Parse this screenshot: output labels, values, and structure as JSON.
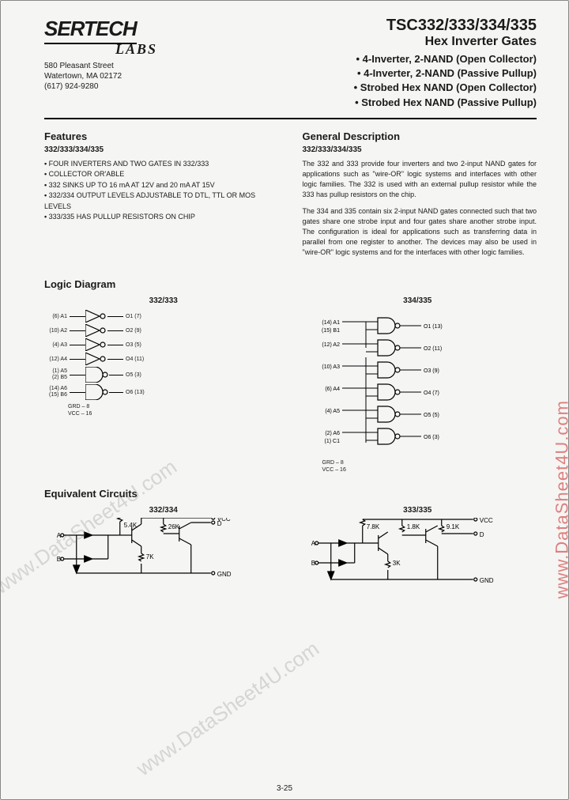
{
  "company": {
    "name": "SERTECH",
    "sublabel": "LABS",
    "address_line1": "580 Pleasant Street",
    "address_line2": "Watertown, MA 02172",
    "phone": "(617) 924-9280"
  },
  "title": {
    "main": "TSC332/333/334/335",
    "sub": "Hex Inverter Gates",
    "lines": [
      "• 4-Inverter, 2-NAND (Open Collector)",
      "• 4-Inverter, 2-NAND (Passive Pullup)",
      "• Strobed Hex NAND (Open Collector)",
      "• Strobed Hex NAND (Passive Pullup)"
    ]
  },
  "features": {
    "heading": "Features",
    "sub": "332/333/334/335",
    "items": [
      "FOUR INVERTERS AND TWO GATES IN 332/333",
      "COLLECTOR OR'ABLE",
      "332 SINKS UP TO 16 mA AT 12V and 20 mA AT 15V",
      "332/334 OUTPUT LEVELS ADJUSTABLE TO DTL, TTL OR MOS LEVELS",
      "333/335 HAS PULLUP RESISTORS ON CHIP"
    ]
  },
  "general": {
    "heading": "General Description",
    "sub": "332/333/334/335",
    "p1": "The 332 and 333 provide four inverters and two 2-input NAND gates for applications such as \"wire-OR\" logic systems and interfaces with other logic families. The 332 is used with an external pullup resistor while the 333 has pullup resistors on the chip.",
    "p2": "The 334 and 335 contain six 2-input NAND gates connected such that two gates share one strobe input and four gates share another strobe input. The configuration is ideal for applications such as transferring data in parallel from one register to another. The devices may also be used in \"wire-OR\" logic systems and for the interfaces with other logic families."
  },
  "logic": {
    "heading": "Logic Diagram",
    "left_title": "332/333",
    "right_title": "334/335",
    "left_rows": [
      {
        "in": "(6) A1",
        "out": "O1 (7)"
      },
      {
        "in": "(10) A2",
        "out": "O2 (9)"
      },
      {
        "in": "(4) A3",
        "out": "O3 (5)"
      },
      {
        "in": "(12) A4",
        "out": "O4 (11)"
      }
    ],
    "left_nand": [
      {
        "a": "(1) A5",
        "b": "(2) B5",
        "out": "O5 (3)"
      },
      {
        "a": "(14) A6",
        "b": "(15) B6",
        "out": "O6 (13)"
      }
    ],
    "right_rows": [
      {
        "a": "(14) A1",
        "b": "(15) B1",
        "out": "O1 (13)"
      },
      {
        "a": "(12) A2",
        "b": "",
        "out": "O2 (11)"
      },
      {
        "a": "(10) A3",
        "b": "",
        "out": "O3 (9)"
      },
      {
        "a": "(6) A4",
        "b": "",
        "out": "O4 (7)"
      },
      {
        "a": "(4) A5",
        "b": "",
        "out": "O5 (5)"
      },
      {
        "a": "(2) A6",
        "b": "(1) C1",
        "out": "O6 (3)"
      }
    ],
    "power": "GRD – 8\nVCC – 16"
  },
  "equiv": {
    "heading": "Equivalent Circuits",
    "left_title": "332/334",
    "right_title": "333/335",
    "labels": {
      "a": "A",
      "b": "B",
      "vcc": "VCC",
      "gnd": "GND",
      "d": "D"
    },
    "r_left": {
      "r1": "5.4K",
      "r2": "26K",
      "r3": "7K"
    },
    "r_right": {
      "r1": "7.8K",
      "r2": "1.8K",
      "r3": "9.1K",
      "r4": "3K"
    }
  },
  "page_number": "3-25",
  "watermarks": {
    "gray": "www.DataSheet4U.com",
    "red": "www.DataSheet4U.com"
  }
}
